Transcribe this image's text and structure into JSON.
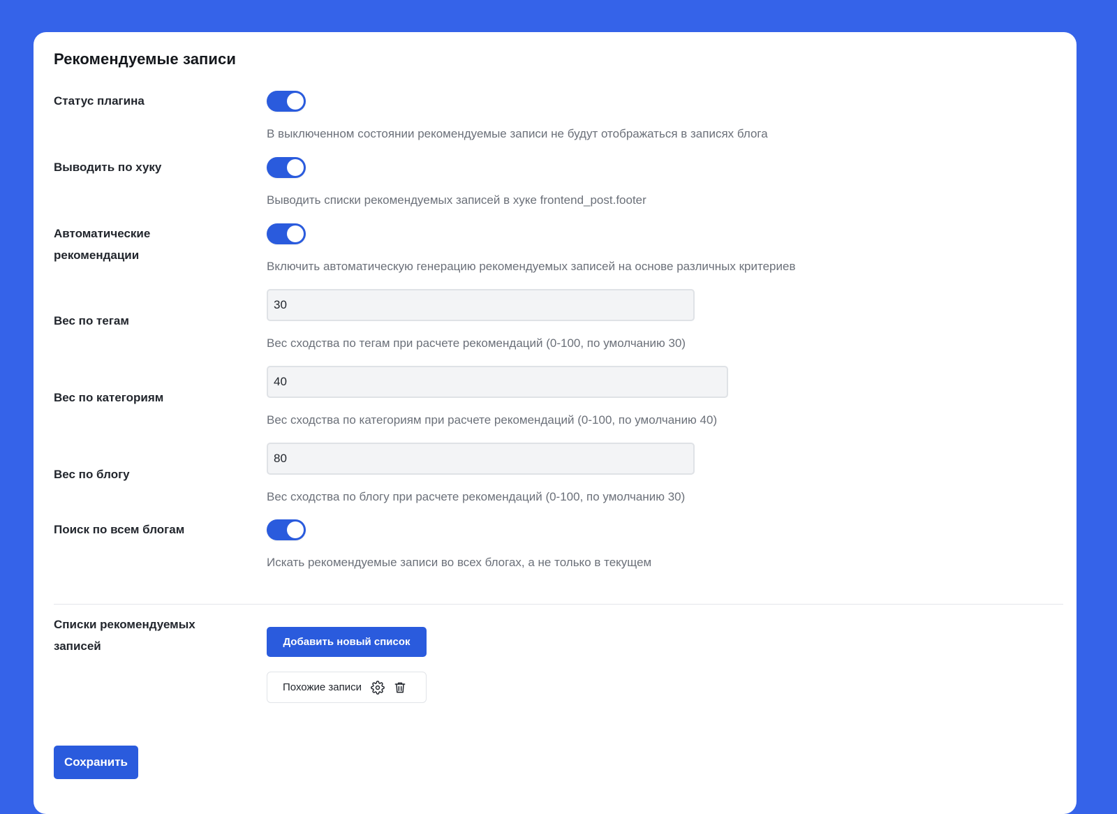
{
  "title": "Рекомендуемые записи",
  "settings": {
    "status": {
      "label": "Статус плагина",
      "enabled": true,
      "hint": "В выключенном состоянии рекомендуемые записи не будут отображаться в записях блога"
    },
    "hook": {
      "label": "Выводить по хуку",
      "enabled": true,
      "hint": "Выводить списки рекомендуемых записей в хуке frontend_post.footer"
    },
    "auto": {
      "label_line1": "Автоматические",
      "label_line2": "рекомендации",
      "enabled": true,
      "hint": "Включить автоматическую генерацию рекомендуемых записей на основе различных критериев"
    },
    "tags_weight": {
      "label": "Вес по тегам",
      "value": "30",
      "hint": "Вес сходства по тегам при расчете рекомендаций (0-100, по умолчанию 30)"
    },
    "categories_weight": {
      "label": "Вес по категориям",
      "value": "40",
      "hint": "Вес сходства по категориям при расчете рекомендаций (0-100, по умолчанию 40)"
    },
    "blog_weight": {
      "label": "Вес по блогу",
      "value": "80",
      "hint": "Вес сходства по блогу при расчете рекомендаций (0-100, по умолчанию 30)"
    },
    "all_blogs": {
      "label": "Поиск по всем блогам",
      "enabled": true,
      "hint": "Искать рекомендуемые записи во всех блогах, а не только в текущем"
    }
  },
  "lists": {
    "label_line1": "Списки рекомендуемых",
    "label_line2": "записей",
    "add_button": "Добавить новый список",
    "items": [
      {
        "name": "Похожие записи",
        "settings_icon": "gear-icon",
        "delete_icon": "trash-icon"
      }
    ]
  },
  "save_button": "Сохранить",
  "colors": {
    "background": "#3563e9",
    "accent": "#2a5bdd",
    "card": "#ffffff",
    "hint_text": "#6b7079"
  }
}
